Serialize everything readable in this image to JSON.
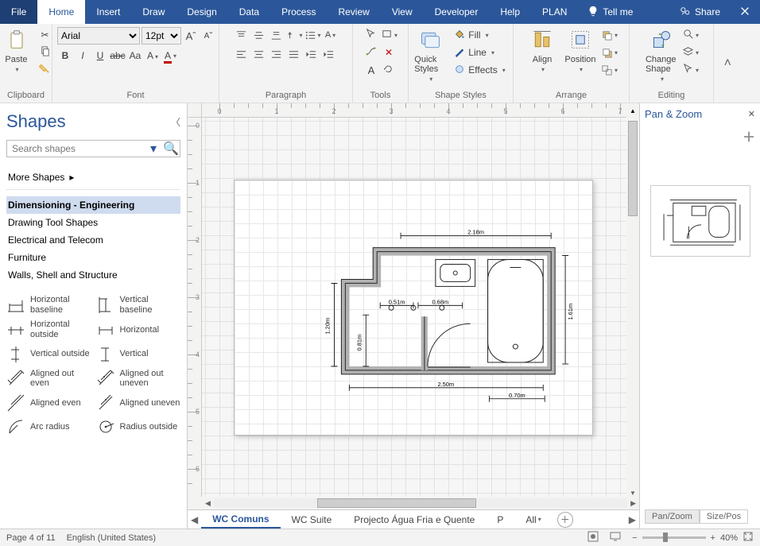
{
  "menubar": {
    "tabs": [
      "File",
      "Home",
      "Insert",
      "Draw",
      "Design",
      "Data",
      "Process",
      "Review",
      "View",
      "Developer",
      "Help",
      "PLAN"
    ],
    "active": 1,
    "tellme": "Tell me",
    "share": "Share"
  },
  "ribbon": {
    "clipboard": {
      "paste": "Paste",
      "label": "Clipboard"
    },
    "font": {
      "name": "Arial",
      "size": "12pt",
      "bold": "B",
      "italic": "I",
      "underline": "U",
      "strike": "abc",
      "case": "Aa",
      "label": "Font"
    },
    "paragraph": {
      "label": "Paragraph"
    },
    "tools": {
      "label": "Tools"
    },
    "shapes": {
      "quick": "Quick Styles",
      "fill": "Fill",
      "line": "Line",
      "effects": "Effects",
      "label": "Shape Styles"
    },
    "arrange": {
      "align": "Align",
      "position": "Position",
      "label": "Arrange"
    },
    "editing": {
      "change": "Change Shape",
      "label": "Editing"
    }
  },
  "shapes_panel": {
    "title": "Shapes",
    "search_placeholder": "Search shapes",
    "more": "More Shapes",
    "categories": [
      "Dimensioning - Engineering",
      "Drawing Tool Shapes",
      "Electrical and Telecom",
      "Furniture",
      "Walls, Shell and Structure"
    ],
    "selectedCategory": 0,
    "stencils": [
      "Horizontal baseline",
      "Vertical baseline",
      "Horizontal outside",
      "Horizontal",
      "Vertical outside",
      "Vertical",
      "Aligned out even",
      "Aligned out uneven",
      "Aligned even",
      "Aligned uneven",
      "Arc radius",
      "Radius outside"
    ]
  },
  "drawing": {
    "dims": {
      "top": "2.18m",
      "right": "1.61m",
      "bottom": "2.50m",
      "bottom_right": "0.70m",
      "left": "1.20m",
      "door": "0.81m",
      "left_seg": "0.51m",
      "mid_seg": "0.68m"
    },
    "ruler_h": [
      "0",
      "1",
      "2",
      "3",
      "4",
      "5",
      "6",
      "7"
    ],
    "ruler_v": [
      "0",
      "1",
      "2",
      "3",
      "4",
      "5",
      "6"
    ]
  },
  "sheet_tabs": {
    "items": [
      "WC Comuns",
      "WC Suite",
      "Projecto Água Fria e Quente",
      "P"
    ],
    "active": 0,
    "all": "All"
  },
  "panzoom": {
    "title": "Pan & Zoom",
    "tabs": [
      "Pan/Zoom",
      "Size/Pos"
    ],
    "active": 0
  },
  "status": {
    "page": "Page 4 of 11",
    "lang": "English (United States)",
    "zoom": "40%"
  }
}
